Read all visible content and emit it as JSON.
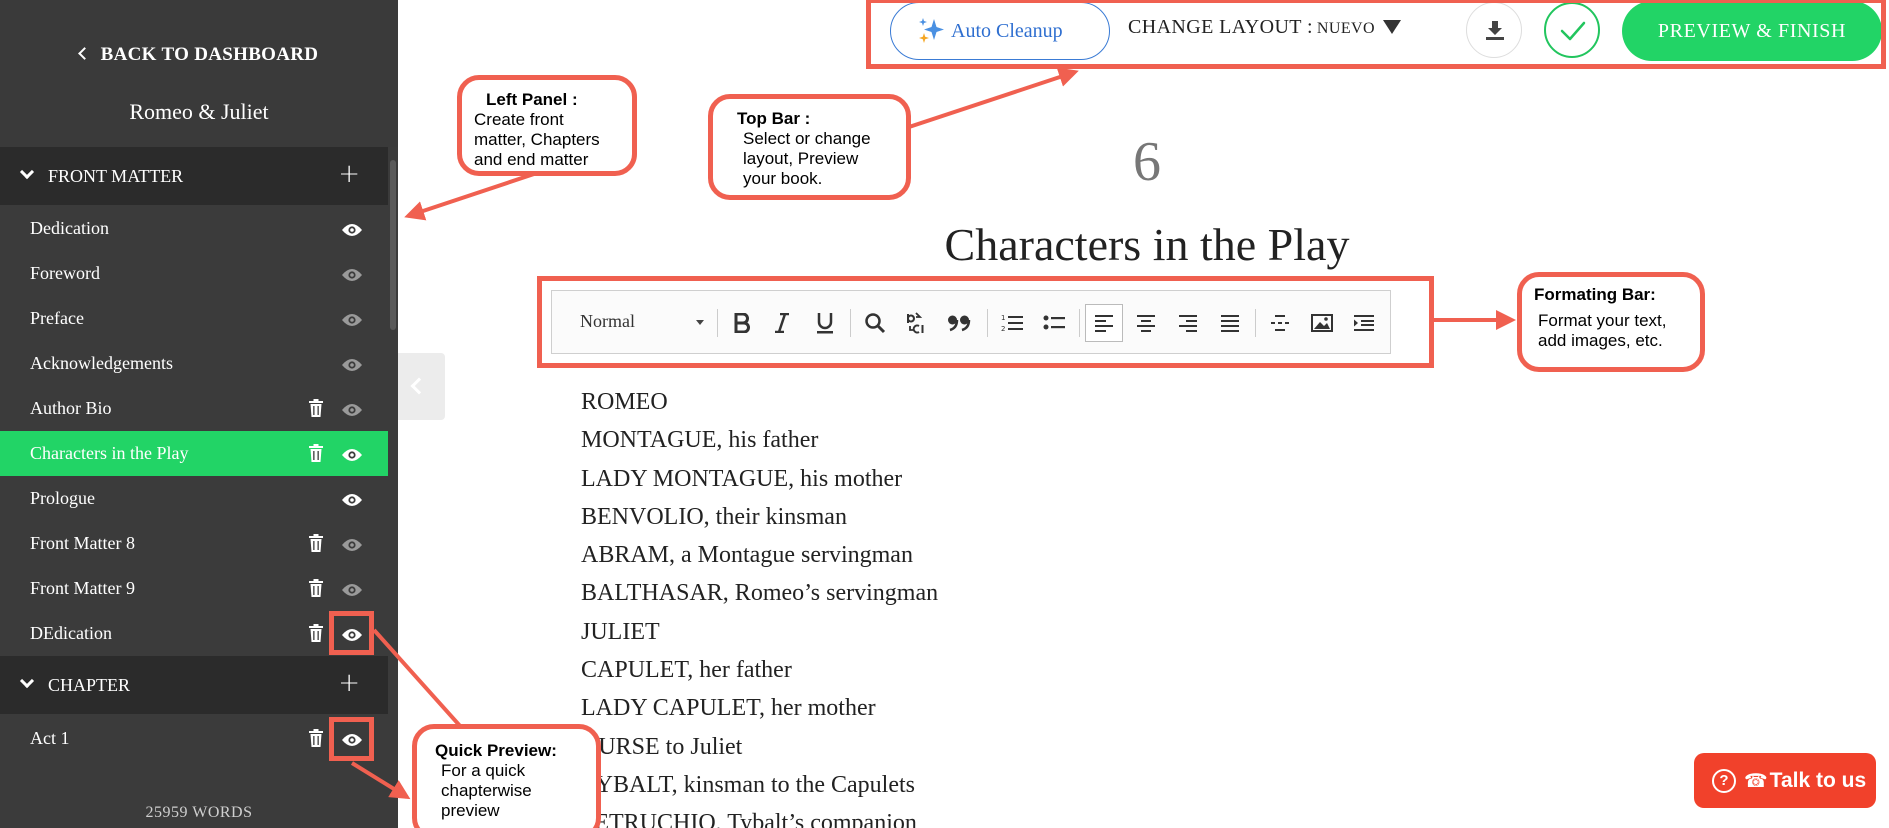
{
  "sidebar": {
    "back_label": "BACK TO DASHBOARD",
    "book_title": "Romeo & Juliet",
    "front_matter_label": "FRONT MATTER",
    "front_matter_items": [
      {
        "label": "Dedication",
        "deletable": false,
        "visible": true
      },
      {
        "label": "Foreword",
        "deletable": false,
        "visible": false
      },
      {
        "label": "Preface",
        "deletable": false,
        "visible": false
      },
      {
        "label": "Acknowledgements",
        "deletable": false,
        "visible": false
      },
      {
        "label": "Author Bio",
        "deletable": true,
        "visible": false
      },
      {
        "label": "Characters in the Play",
        "deletable": true,
        "visible": true,
        "active": true
      },
      {
        "label": "Prologue",
        "deletable": false,
        "visible": true
      },
      {
        "label": "Front Matter 8",
        "deletable": true,
        "visible": false
      },
      {
        "label": "Front Matter 9",
        "deletable": true,
        "visible": false
      },
      {
        "label": "DEdication",
        "deletable": true,
        "visible": true
      }
    ],
    "chapter_label": "CHAPTER",
    "chapter_items": [
      {
        "label": "Act 1",
        "deletable": true,
        "visible": true
      }
    ],
    "word_count": "25959 WORDS"
  },
  "topbar": {
    "auto_cleanup": "Auto Cleanup",
    "change_layout_label": "CHANGE LAYOUT :",
    "layout_name": "NUEVO",
    "preview_finish": "PREVIEW & FINISH"
  },
  "editor": {
    "chapter_number": "6",
    "chapter_title": "Characters in the Play",
    "toolbar": {
      "paragraph_style": "Normal"
    },
    "lines": [
      "ROMEO",
      "MONTAGUE, his father",
      "LADY MONTAGUE, his mother",
      "BENVOLIO, their kinsman",
      "ABRAM, a Montague servingman",
      "BALTHASAR, Romeo’s servingman",
      "JULIET",
      "CAPULET, her father",
      "LADY CAPULET, her mother",
      "NURSE to Juliet",
      "TYBALT, kinsman to the Capulets",
      "PETRUCHIO, Tybalt’s companion"
    ]
  },
  "support": {
    "talk_label": "Talk to us"
  },
  "annotations": {
    "left_panel": {
      "title": "Left Panel :",
      "body": "Create front matter, Chapters and end matter"
    },
    "top_bar": {
      "title": "Top Bar :",
      "body": "Select or change layout, Preview your book."
    },
    "formatting_bar": {
      "title": "Formating Bar:",
      "body": "Format your text, add images, etc."
    },
    "quick_preview": {
      "title": "Quick Preview:",
      "body": "For a quick chapterwise preview"
    }
  },
  "colors": {
    "sidebar_bg": "#3b3b3b",
    "section_bg": "#2b2b2b",
    "accent_green": "#22d466",
    "annotation_red": "#f06050",
    "cleanup_blue": "#2f6fd0",
    "talk_red": "#f1412b"
  }
}
